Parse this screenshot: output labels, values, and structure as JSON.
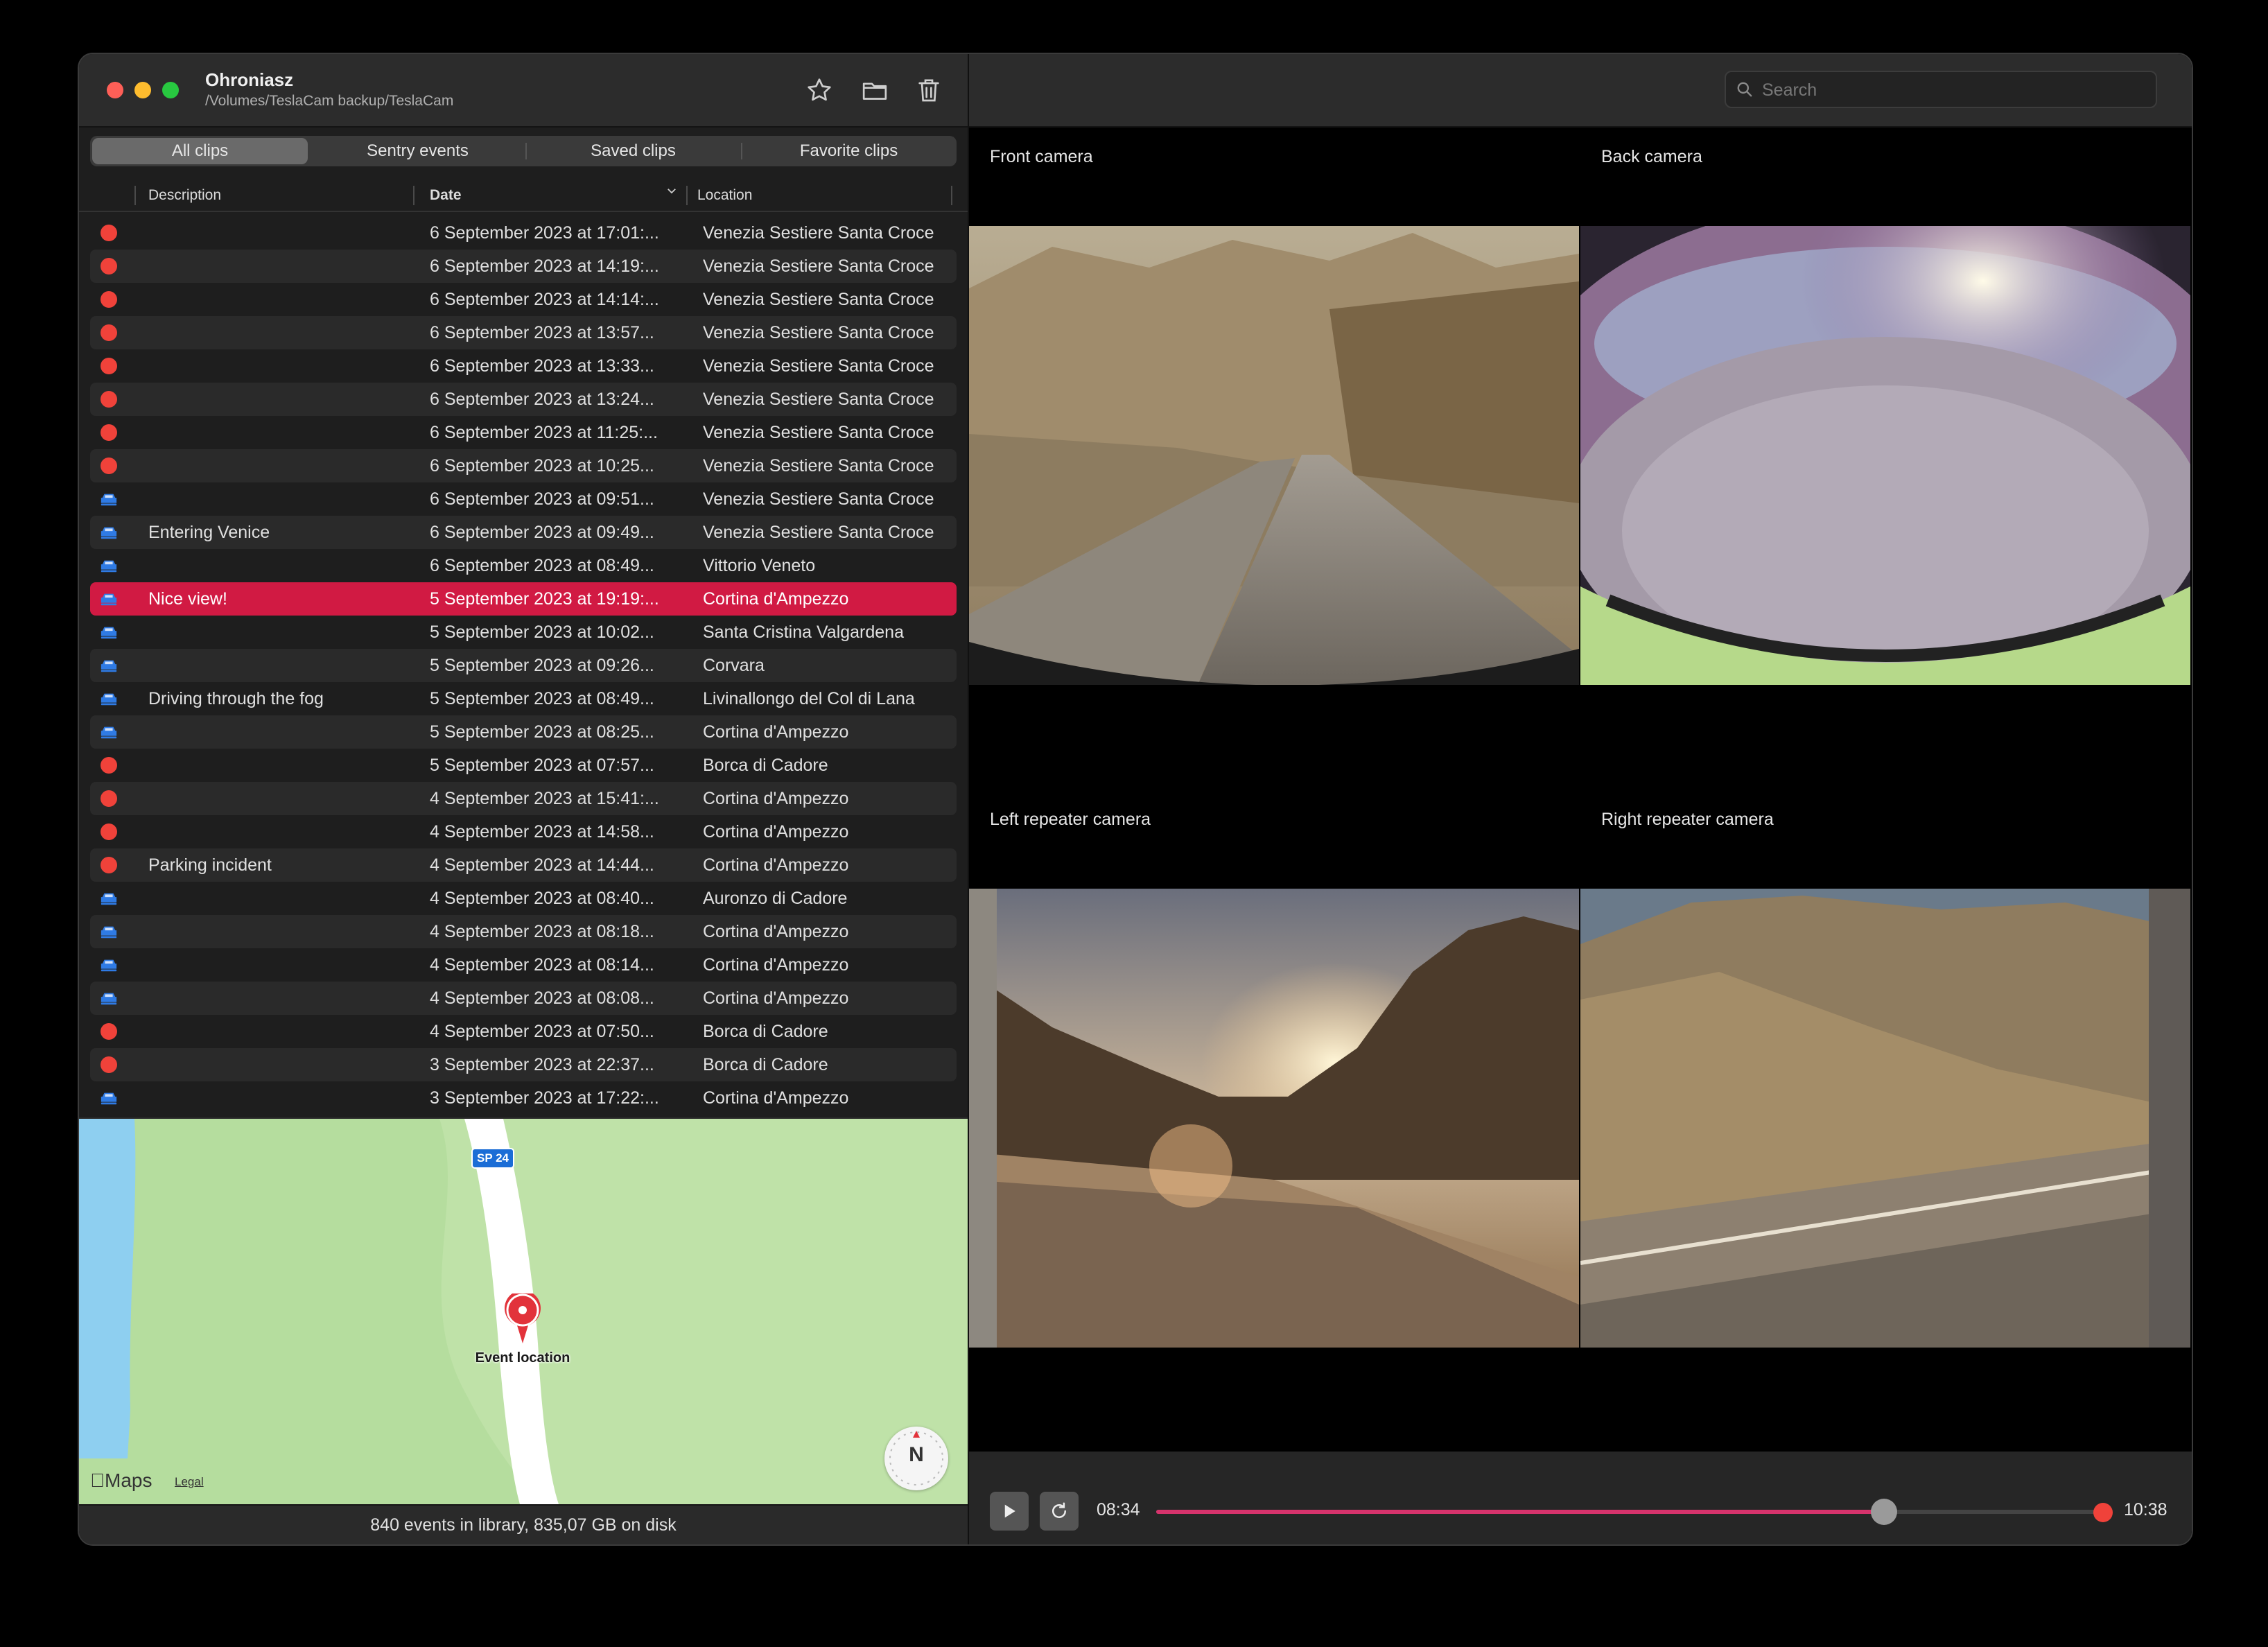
{
  "app": {
    "title": "Ohroniasz",
    "path": "/Volumes/TeslaCam backup/TeslaCam"
  },
  "toolbar": {
    "favorite_icon": "star-icon",
    "folder_icon": "folder-icon",
    "delete_icon": "trash-icon"
  },
  "tabs": [
    "All clips",
    "Sentry events",
    "Saved clips",
    "Favorite clips"
  ],
  "active_tab": "All clips",
  "columns": {
    "description": "Description",
    "date": "Date",
    "location": "Location"
  },
  "colors": {
    "selection": "#d11a43",
    "sentry": "#f0423a",
    "saved": "#2f7be5",
    "progress": "#d6336c"
  },
  "events": [
    {
      "type": "sentry",
      "description": "",
      "date": "6 September 2023 at 17:01:...",
      "location": "Venezia Sestiere Santa Croce"
    },
    {
      "type": "sentry",
      "description": "",
      "date": "6 September 2023 at 14:19:...",
      "location": "Venezia Sestiere Santa Croce"
    },
    {
      "type": "sentry",
      "description": "",
      "date": "6 September 2023 at 14:14:...",
      "location": "Venezia Sestiere Santa Croce"
    },
    {
      "type": "sentry",
      "description": "",
      "date": "6 September 2023 at 13:57...",
      "location": "Venezia Sestiere Santa Croce"
    },
    {
      "type": "sentry",
      "description": "",
      "date": "6 September 2023 at 13:33...",
      "location": "Venezia Sestiere Santa Croce"
    },
    {
      "type": "sentry",
      "description": "",
      "date": "6 September 2023 at 13:24...",
      "location": "Venezia Sestiere Santa Croce"
    },
    {
      "type": "sentry",
      "description": "",
      "date": "6 September 2023 at 11:25:...",
      "location": "Venezia Sestiere Santa Croce"
    },
    {
      "type": "sentry",
      "description": "",
      "date": "6 September 2023 at 10:25...",
      "location": "Venezia Sestiere Santa Croce"
    },
    {
      "type": "saved",
      "description": "",
      "date": "6 September 2023 at 09:51...",
      "location": "Venezia Sestiere Santa Croce"
    },
    {
      "type": "saved",
      "description": "Entering Venice",
      "date": "6 September 2023 at 09:49...",
      "location": "Venezia Sestiere Santa Croce"
    },
    {
      "type": "saved",
      "description": "",
      "date": "6 September 2023 at 08:49...",
      "location": "Vittorio Veneto"
    },
    {
      "type": "saved",
      "description": "Nice view!",
      "date": "5 September 2023 at 19:19:...",
      "location": "Cortina d'Ampezzo",
      "selected": true
    },
    {
      "type": "saved",
      "description": "",
      "date": "5 September 2023 at 10:02...",
      "location": "Santa Cristina Valgardena"
    },
    {
      "type": "saved",
      "description": "",
      "date": "5 September 2023 at 09:26...",
      "location": "Corvara"
    },
    {
      "type": "saved",
      "description": "Driving through the fog",
      "date": "5 September 2023 at 08:49...",
      "location": "Livinallongo del Col di Lana"
    },
    {
      "type": "saved",
      "description": "",
      "date": "5 September 2023 at 08:25...",
      "location": "Cortina d'Ampezzo"
    },
    {
      "type": "sentry",
      "description": "",
      "date": "5 September 2023 at 07:57...",
      "location": "Borca di Cadore"
    },
    {
      "type": "sentry",
      "description": "",
      "date": "4 September 2023 at 15:41:...",
      "location": "Cortina d'Ampezzo"
    },
    {
      "type": "sentry",
      "description": "",
      "date": "4 September 2023 at 14:58...",
      "location": "Cortina d'Ampezzo"
    },
    {
      "type": "sentry",
      "description": "Parking incident",
      "date": "4 September 2023 at 14:44...",
      "location": "Cortina d'Ampezzo"
    },
    {
      "type": "saved",
      "description": "",
      "date": "4 September 2023 at 08:40...",
      "location": "Auronzo di Cadore"
    },
    {
      "type": "saved",
      "description": "",
      "date": "4 September 2023 at 08:18...",
      "location": "Cortina d'Ampezzo"
    },
    {
      "type": "saved",
      "description": "",
      "date": "4 September 2023 at 08:14...",
      "location": "Cortina d'Ampezzo"
    },
    {
      "type": "saved",
      "description": "",
      "date": "4 September 2023 at 08:08...",
      "location": "Cortina d'Ampezzo"
    },
    {
      "type": "sentry",
      "description": "",
      "date": "4 September 2023 at 07:50...",
      "location": "Borca di Cadore"
    },
    {
      "type": "sentry",
      "description": "",
      "date": "3 September 2023 at 22:37...",
      "location": "Borca di Cadore"
    },
    {
      "type": "saved",
      "description": "",
      "date": "3 September 2023 at 17:22:...",
      "location": "Cortina d'Ampezzo"
    }
  ],
  "map": {
    "road_badge": "SP 24",
    "pin_label": "Event location",
    "maps_brand": "Maps",
    "legal": "Legal",
    "compass": "N"
  },
  "status": "840 events in library, 835,07 GB on disk",
  "search": {
    "placeholder": "Search",
    "value": ""
  },
  "cameras": {
    "front": "Front camera",
    "back": "Back camera",
    "left": "Left repeater camera",
    "right": "Right repeater camera"
  },
  "player": {
    "current_time": "08:34",
    "end_time": "10:38",
    "progress": 0.77
  }
}
